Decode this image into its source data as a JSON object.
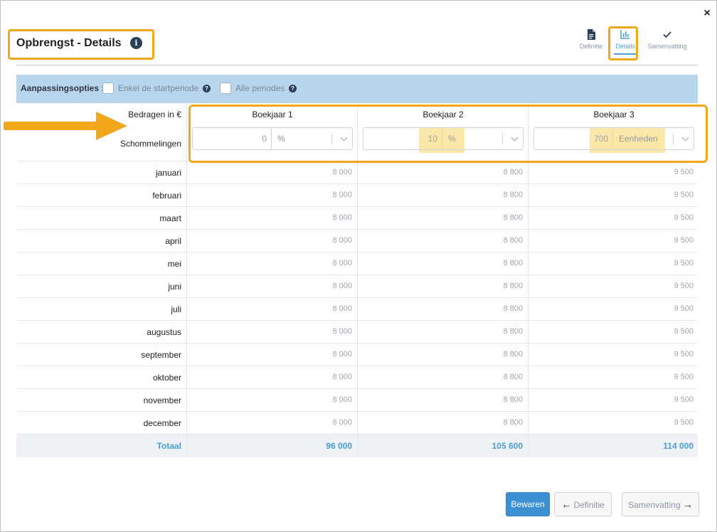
{
  "modal": {
    "title": "Opbrengst - Details",
    "close_label": "×"
  },
  "stepper": {
    "steps": [
      {
        "label": "Definitie",
        "icon": "file-icon"
      },
      {
        "label": "Details",
        "icon": "bar-chart-icon"
      },
      {
        "label": "Samenvatting",
        "icon": "check-icon"
      }
    ],
    "active": "Details"
  },
  "options": {
    "label": "Aanpassingsopties :",
    "opt1": "Enkel de startperiode",
    "opt2": "Alle periodes",
    "help": "?"
  },
  "table": {
    "amounts_label": "Bedragen in €",
    "fluctuations_label": "Schommelingen",
    "years": [
      "Boekjaar 1",
      "Boekjaar 2",
      "Boekjaar 3"
    ],
    "fluctuations": [
      {
        "value": "0",
        "unit": "%"
      },
      {
        "value": "10",
        "unit": "%"
      },
      {
        "value": "700",
        "unit": "Eenheden"
      }
    ],
    "rows": [
      {
        "month": "januari",
        "values": [
          "8 000",
          "8 800",
          "9 500"
        ]
      },
      {
        "month": "februari",
        "values": [
          "8 000",
          "8 800",
          "9 500"
        ]
      },
      {
        "month": "maart",
        "values": [
          "8 000",
          "8 800",
          "9 500"
        ]
      },
      {
        "month": "april",
        "values": [
          "8 000",
          "8 800",
          "9 500"
        ]
      },
      {
        "month": "mei",
        "values": [
          "8 000",
          "8 800",
          "9 500"
        ]
      },
      {
        "month": "juni",
        "values": [
          "8 000",
          "8 800",
          "9 500"
        ]
      },
      {
        "month": "juli",
        "values": [
          "8 000",
          "8 800",
          "9 500"
        ]
      },
      {
        "month": "augustus",
        "values": [
          "8 000",
          "8 800",
          "9 500"
        ]
      },
      {
        "month": "september",
        "values": [
          "8 000",
          "8 800",
          "9 500"
        ]
      },
      {
        "month": "oktober",
        "values": [
          "8 000",
          "8 800",
          "9 500"
        ]
      },
      {
        "month": "november",
        "values": [
          "8 000",
          "8 800",
          "9 500"
        ]
      },
      {
        "month": "december",
        "values": [
          "8 000",
          "8 800",
          "9 500"
        ]
      }
    ],
    "total": {
      "label": "Totaal",
      "values": [
        "96 000",
        "105 600",
        "114 000"
      ]
    }
  },
  "buttons": {
    "save": "Bewaren",
    "prev": "Definitie",
    "next": "Samenvatting"
  },
  "colors": {
    "accent": "#3b8fd2",
    "highlight": "#f2a71b",
    "option_bar": "#b8d5ee",
    "total_text": "#4a9fd0"
  }
}
